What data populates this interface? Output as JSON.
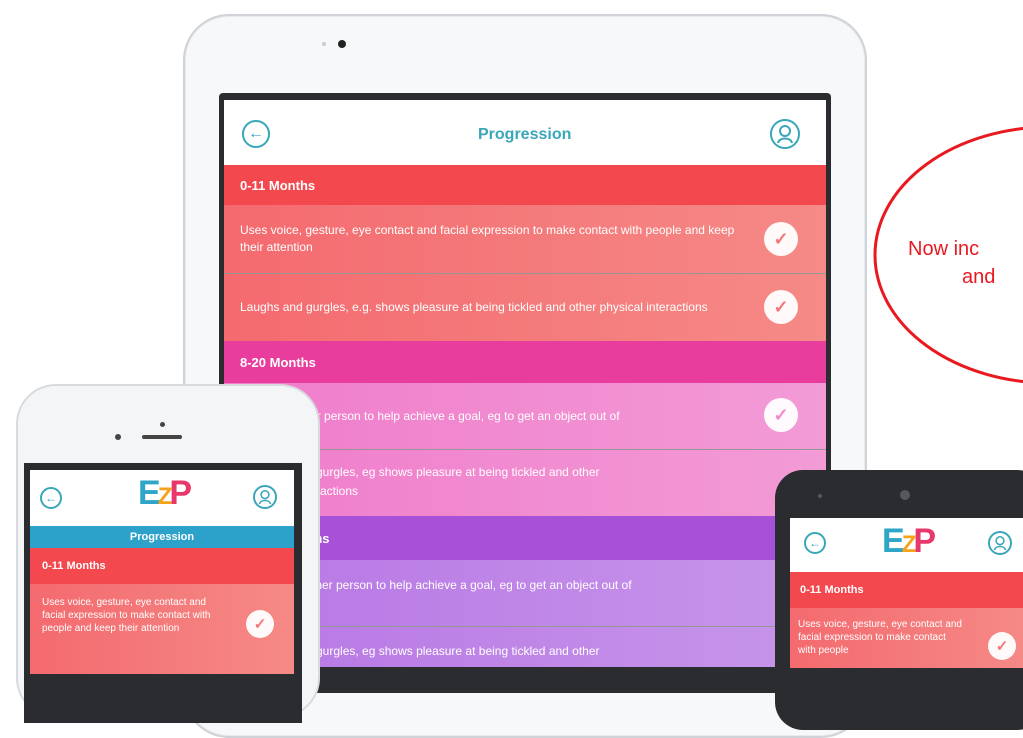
{
  "tablet": {
    "title": "Progression",
    "sections": [
      {
        "label": "0-11 Months",
        "color": "#f2484e"
      },
      {
        "label": "8-20 Months",
        "color": "#e93d9e"
      },
      {
        "label": "ths",
        "color": "#a651d8"
      }
    ],
    "items": [
      "Uses voice, gesture, eye contact and facial expression to make contact with people and keep their attention",
      "Laughs and gurgles, e.g. shows pleasure at being tickled and other physical interactions",
      "s other person to help achieve a goal, eg to get an object out of",
      "d gurgles, eg shows pleasure at being tickled and other",
      "ther person to help achieve a goal, eg to get an object out of",
      "d gurgles, eg shows pleasure at being tickled and other"
    ],
    "item3_line2": "teractions"
  },
  "callout": {
    "line1": "Now inc",
    "line2": "and",
    "color": "#e8191f"
  },
  "phone": {
    "logo_e": "E",
    "logo_z": "Z",
    "logo_p": "P",
    "banner": "Progression",
    "section": "0-11 Months",
    "item": "Uses voice, gesture, eye contact and facial expression to make contact with people and keep their attention"
  },
  "android": {
    "logo_e": "E",
    "logo_z": "Z",
    "logo_p": "P",
    "section": "0-11 Months",
    "item": "Uses voice, gesture, eye contact and facial expression to make contact with people"
  },
  "icons": {
    "back": "arrow-left-icon",
    "profile": "user-icon",
    "check": "check-icon"
  }
}
